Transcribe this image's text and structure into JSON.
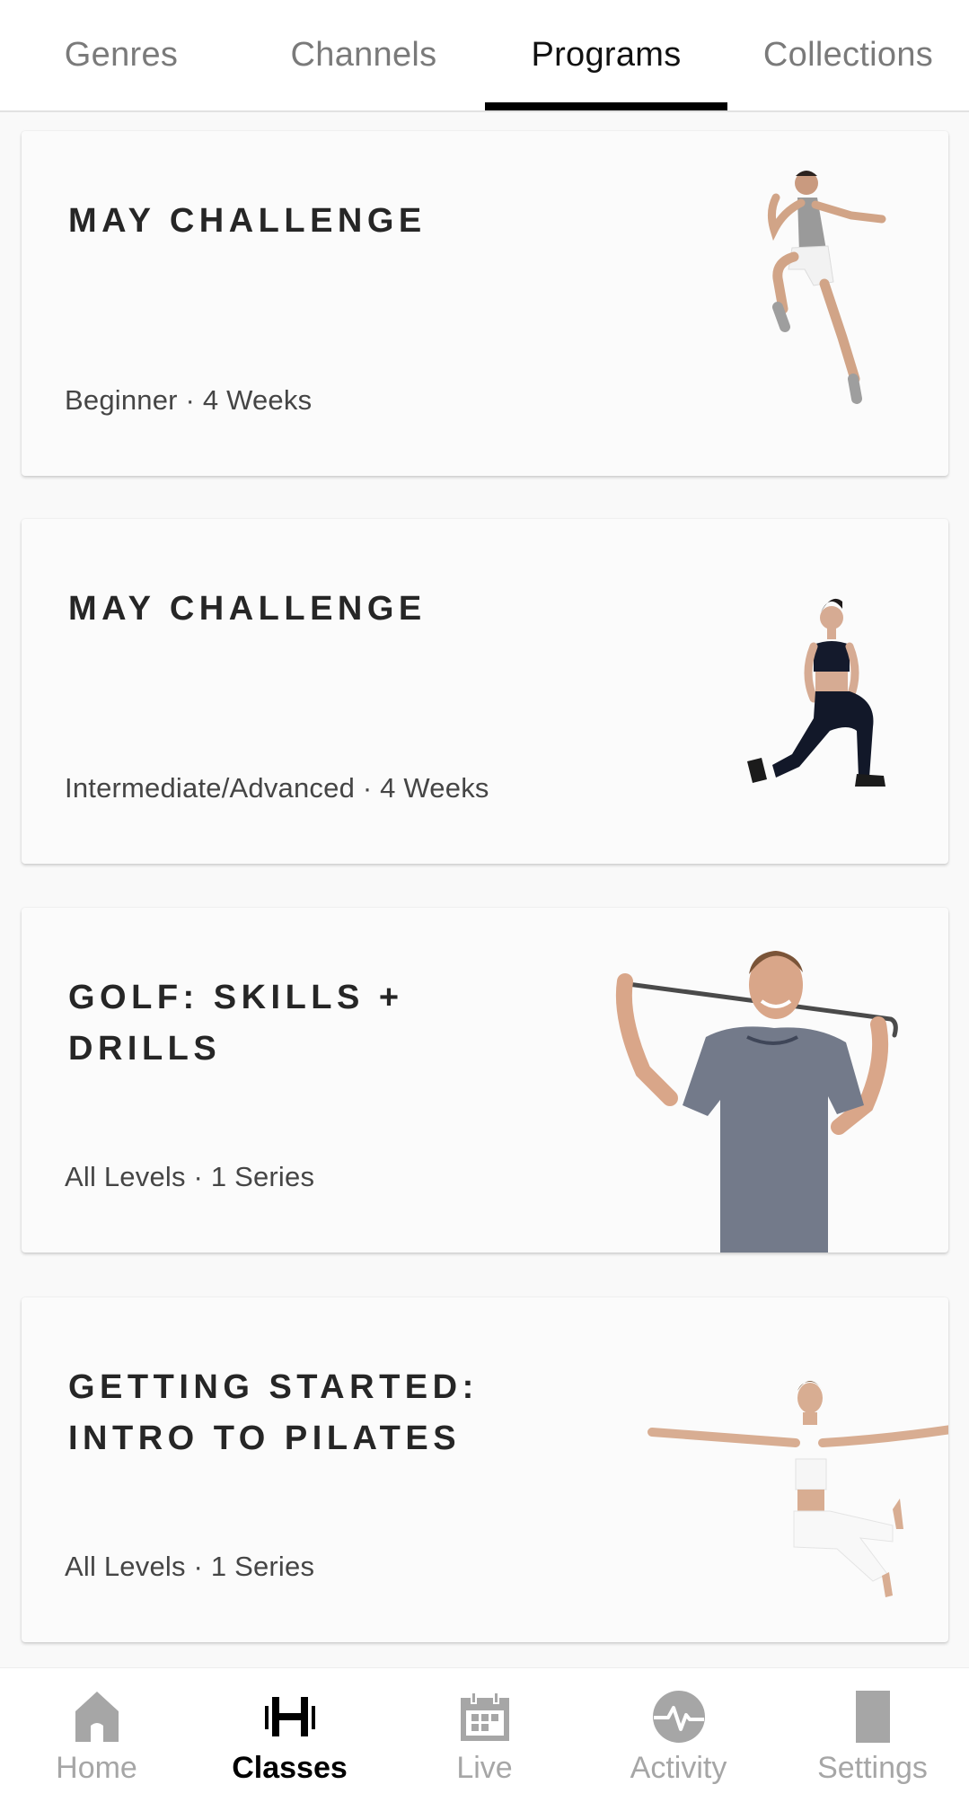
{
  "tabs": [
    {
      "label": "Genres",
      "active": false
    },
    {
      "label": "Channels",
      "active": false
    },
    {
      "label": "Programs",
      "active": true
    },
    {
      "label": "Collections",
      "active": false
    }
  ],
  "programs": [
    {
      "title": "MAY CHALLENGE",
      "meta": "Beginner · 4 Weeks",
      "image": "man-jumping-grey-tank"
    },
    {
      "title": "MAY CHALLENGE",
      "meta": "Intermediate/Advanced · 4 Weeks",
      "image": "woman-lunge-dumbbell"
    },
    {
      "title": "GOLF: SKILLS + DRILLS",
      "meta": "All Levels · 1 Series",
      "image": "man-golf-club-shoulders"
    },
    {
      "title": "GETTING STARTED: INTRO TO PILATES",
      "meta": "All Levels · 1 Series",
      "image": "woman-pilates-seated-balance"
    }
  ],
  "bottom_nav": [
    {
      "label": "Home",
      "icon": "home-icon",
      "active": false
    },
    {
      "label": "Classes",
      "icon": "dumbbell-icon",
      "active": true
    },
    {
      "label": "Live",
      "icon": "calendar-icon",
      "active": false
    },
    {
      "label": "Activity",
      "icon": "activity-pulse-icon",
      "active": false
    },
    {
      "label": "Settings",
      "icon": "settings-icon",
      "active": false
    }
  ],
  "colors": {
    "active_text": "#111111",
    "inactive_text": "#7a7a7a",
    "nav_inactive": "#a6a6a6",
    "underline": "#000000",
    "card_bg": "#fbfbfb",
    "page_bg": "#f9f9f9"
  }
}
